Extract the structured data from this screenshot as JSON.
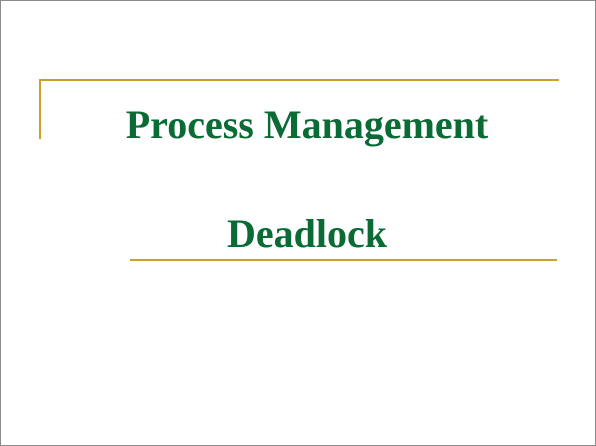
{
  "slide": {
    "title_line_1": "Process Management",
    "title_line_2": "Deadlock"
  },
  "colors": {
    "title_text": "#0b6b35",
    "accent_rule": "#c9a227",
    "background": "#ffffff",
    "border": "#8a8a8a"
  }
}
